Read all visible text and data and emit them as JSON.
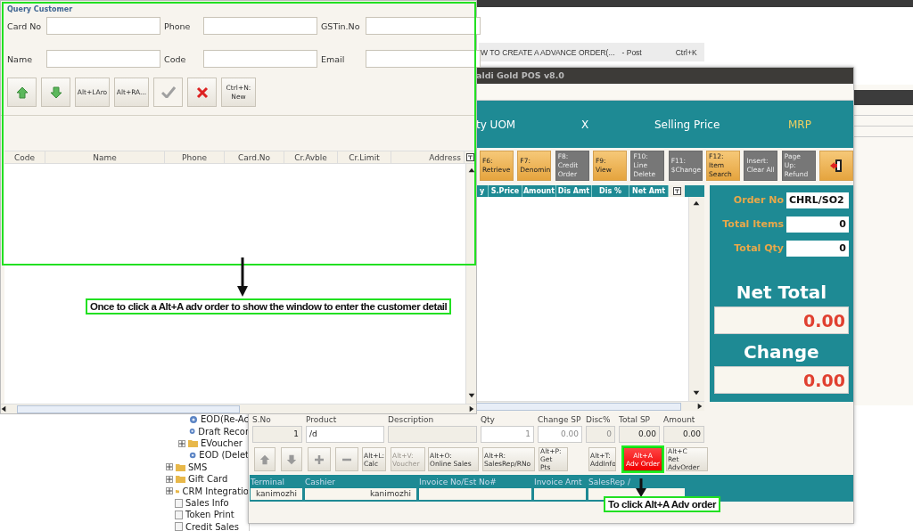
{
  "browser_tab": {
    "title": "W TO CREATE A ADVANCE ORDER(...",
    "suffix": "- Post",
    "shortcut": "Ctrl+K"
  },
  "tree": {
    "branch_items": [
      {
        "label": "EOD(Re-Ac",
        "kind": "gear"
      },
      {
        "label": "Draft Recor",
        "kind": "gear"
      },
      {
        "label": "EVoucher",
        "kind": "folder",
        "expanded": false
      },
      {
        "label": "EOD (Delet",
        "kind": "gear"
      }
    ],
    "items": [
      {
        "label": "SMS",
        "kind": "folder",
        "expanded": false
      },
      {
        "label": "Gift Card",
        "kind": "folder",
        "expanded": false
      },
      {
        "label": "CRM Integratio",
        "kind": "folder",
        "expanded": false
      },
      {
        "label": "Sales Info",
        "kind": "page"
      },
      {
        "label": "Token Print",
        "kind": "page"
      },
      {
        "label": "Credit Sales",
        "kind": "page"
      }
    ]
  },
  "query_dialog": {
    "title": "Query Customer",
    "fields": [
      {
        "label": "Card No"
      },
      {
        "label": "Phone"
      },
      {
        "label": "GSTin.No"
      },
      {
        "label": "Name"
      },
      {
        "label": "Code"
      },
      {
        "label": "Email"
      }
    ],
    "buttons": [
      {
        "kind": "up",
        "disabled": false
      },
      {
        "kind": "down",
        "disabled": false
      },
      {
        "kind": "text",
        "label": "Alt+LAro",
        "disabled": false
      },
      {
        "kind": "text",
        "label": "Alt+RA...",
        "disabled": false
      },
      {
        "kind": "check",
        "disabled": true
      },
      {
        "kind": "cross",
        "disabled": false
      },
      {
        "kind": "text",
        "label": "Ctrl+N:\nNew",
        "disabled": false
      }
    ],
    "columns": [
      "Code",
      "Name",
      "Phone",
      "Card.No",
      "Cr.Avble",
      "Cr.Limit",
      "Address"
    ]
  },
  "pos": {
    "title": "aldi Gold POS v8.0",
    "header": [
      {
        "label": "ty UOM",
        "highlight": false
      },
      {
        "label": "X",
        "highlight": false
      },
      {
        "label": "Selling Price",
        "highlight": false
      },
      {
        "label": "MRP",
        "highlight": true
      }
    ],
    "toolbar": [
      {
        "kind": "text",
        "label": "F6:\nRetrieve",
        "disabled": false
      },
      {
        "kind": "text",
        "label": "F7:\nDenomin",
        "disabled": false
      },
      {
        "kind": "text",
        "label": "F8:\nCredit\nOrder",
        "disabled": true
      },
      {
        "kind": "text",
        "label": "F9:\nView",
        "disabled": false
      },
      {
        "kind": "text",
        "label": "F10:\nLine\nDelete",
        "disabled": true
      },
      {
        "kind": "text",
        "label": "F11:\n$Change",
        "disabled": true
      },
      {
        "kind": "text",
        "label": "F12:\nItem\nSearch",
        "disabled": false
      },
      {
        "kind": "text",
        "label": "Insert:\nClear All",
        "disabled": true
      },
      {
        "kind": "text",
        "label": "Page\nUp:\nRefund",
        "disabled": true
      },
      {
        "kind": "exit",
        "disabled": false
      }
    ],
    "grid_columns": [
      "y",
      "S.Price",
      "Amount",
      "Dis Amt",
      "Dis %",
      "Net Amt"
    ],
    "summary": {
      "fields": [
        {
          "label": "Order No",
          "value": "CHRL/SO2"
        },
        {
          "label": "Total Items",
          "value": "0"
        },
        {
          "label": "Total Qty",
          "value": "0"
        }
      ],
      "totals": [
        {
          "label": "Net Total",
          "value": "0.00"
        },
        {
          "label": "Change",
          "value": "0.00"
        }
      ]
    },
    "entry": [
      {
        "label": "S.No",
        "value": "1",
        "kind": "display",
        "disabled": false
      },
      {
        "label": "Product",
        "value": "/d",
        "kind": "input",
        "disabled": false
      },
      {
        "label": "Description",
        "kind": "display"
      },
      {
        "label": "Qty",
        "value": "1",
        "kind": "input",
        "disabled": true
      },
      {
        "label": "Change SP",
        "value": "0.00",
        "kind": "input",
        "disabled": true
      },
      {
        "label": "Disc%",
        "value": "0",
        "kind": "display",
        "disabled": true
      },
      {
        "label": "Total SP",
        "value": "0.00",
        "kind": "display",
        "disabled": false
      },
      {
        "label": "Amount",
        "value": "0.00",
        "kind": "display",
        "disabled": false
      }
    ],
    "actions": [
      {
        "kind": "up",
        "disabled": true
      },
      {
        "kind": "down",
        "disabled": true
      },
      {
        "kind": "plus",
        "disabled": true
      },
      {
        "kind": "minus",
        "disabled": true
      },
      {
        "kind": "text",
        "label": "Alt+L:\nCalc",
        "disabled": false,
        "selected": false
      },
      {
        "kind": "text",
        "label": "Alt+V:\nVoucher",
        "disabled": true,
        "selected": false
      },
      {
        "kind": "text",
        "label": "Alt+O:\nOnline Sales",
        "disabled": false,
        "selected": false
      },
      {
        "kind": "text",
        "label": "Alt+R:\nSalesRep/RNo",
        "disabled": false,
        "selected": false
      },
      {
        "kind": "text",
        "label": "Alt+P:\nGet\nPts",
        "disabled": false,
        "selected": false
      },
      {
        "kind": "text",
        "label": "Alt+T:\nAddInfo",
        "disabled": false,
        "selected": false
      },
      {
        "kind": "text",
        "label": "Alt+A\nAdv Order",
        "disabled": false,
        "selected": true
      },
      {
        "kind": "text",
        "label": "Alt+C\nRet\nAdvOrder",
        "disabled": false,
        "selected": false
      }
    ],
    "footer": [
      {
        "label": "Terminal",
        "value": "kanimozhi"
      },
      {
        "label": "Cashier",
        "value": "kanimozhi"
      },
      {
        "label": "Invoice No/Est No#"
      },
      {
        "label": "Invoice Amt"
      },
      {
        "label": "SalesRep /"
      }
    ]
  },
  "annotations": [
    {
      "text": "Once to click a Alt+A adv order to show the  window to enter the customer detail"
    },
    {
      "text": "To click Alt+A Adv order"
    }
  ]
}
